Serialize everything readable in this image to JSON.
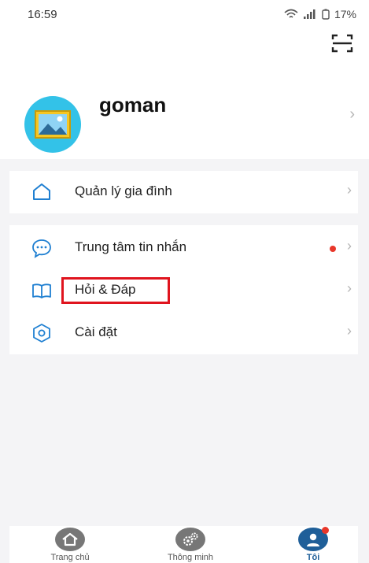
{
  "status_bar": {
    "time": "16:59",
    "battery": "17%"
  },
  "profile": {
    "username": "goman"
  },
  "menu": {
    "family": {
      "label": "Quản lý gia đình"
    },
    "messages": {
      "label": "Trung tâm tin nhắn"
    },
    "qa": {
      "label": "Hỏi & Đáp"
    },
    "settings": {
      "label": "Cài đặt"
    }
  },
  "bottom_nav": {
    "items": [
      {
        "label": "Trang chủ",
        "icon": "home-icon"
      },
      {
        "label": "Thông minh",
        "icon": "gears-icon"
      },
      {
        "label": "Tôi",
        "icon": "user-icon"
      }
    ]
  },
  "colors": {
    "accent": "#1f5f99",
    "badge": "#e8372a",
    "highlight": "#e0141e",
    "avatar_bg": "#33c2e8"
  }
}
